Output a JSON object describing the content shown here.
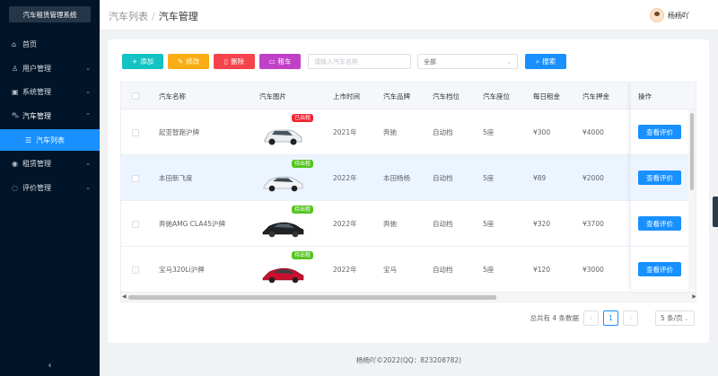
{
  "app": {
    "title": "汽车租赁管理系统"
  },
  "sidebar": {
    "items": [
      {
        "label": "首页",
        "icon": "home-icon"
      },
      {
        "label": "用户管理",
        "icon": "user-icon"
      },
      {
        "label": "系统管理",
        "icon": "settings-icon"
      },
      {
        "label": "汽车管理",
        "icon": "car-icon"
      },
      {
        "label": "汽车列表",
        "icon": "list-icon"
      },
      {
        "label": "租赁管理",
        "icon": "rent-icon"
      },
      {
        "label": "评价管理",
        "icon": "comment-icon"
      }
    ]
  },
  "header": {
    "breadcrumb": [
      "汽车列表",
      "汽车管理"
    ],
    "user": "杨杨吖"
  },
  "toolbar": {
    "add": "添加",
    "edit": "修改",
    "delete": "删除",
    "rent": "租车",
    "search_placeholder": "请输入汽车名称",
    "filter_value": "全部",
    "search": "搜索"
  },
  "table": {
    "columns": [
      "汽车名称",
      "汽车图片",
      "上市时间",
      "汽车品牌",
      "汽车档位",
      "汽车座位",
      "每日租金",
      "汽车押金",
      "操作"
    ],
    "rows": [
      {
        "name": "起亚智跑沪牌",
        "status": "已出租",
        "year": "2021年",
        "brand": "奔驰",
        "gear": "自动档",
        "seats": "5座",
        "rent": "¥300",
        "deposit": "¥4000",
        "action": "查看评价"
      },
      {
        "name": "本田新飞度",
        "status": "待出租",
        "year": "2022年",
        "brand": "本田杨杨",
        "gear": "自动档",
        "seats": "5座",
        "rent": "¥89",
        "deposit": "¥2000",
        "action": "查看评价"
      },
      {
        "name": "奔驰AMG CLA45沪牌",
        "status": "待出租",
        "year": "2022年",
        "brand": "奔驰",
        "gear": "自动档",
        "seats": "5座",
        "rent": "¥320",
        "deposit": "¥3700",
        "action": "查看评价"
      },
      {
        "name": "宝马320Li沪牌",
        "status": "待出租",
        "year": "2022年",
        "brand": "宝马",
        "gear": "自动档",
        "seats": "5座",
        "rent": "¥120",
        "deposit": "¥3000",
        "action": "查看评价"
      }
    ]
  },
  "pagination": {
    "total": "总共有 4 条数据",
    "page": "1",
    "size": "5 条/页"
  },
  "footer": "杨杨吖©2022(QQ：823208782)",
  "colors": {
    "primary": "#1890ff",
    "sidebar": "#001529",
    "rented": "#f5222d",
    "available": "#52c41a"
  }
}
